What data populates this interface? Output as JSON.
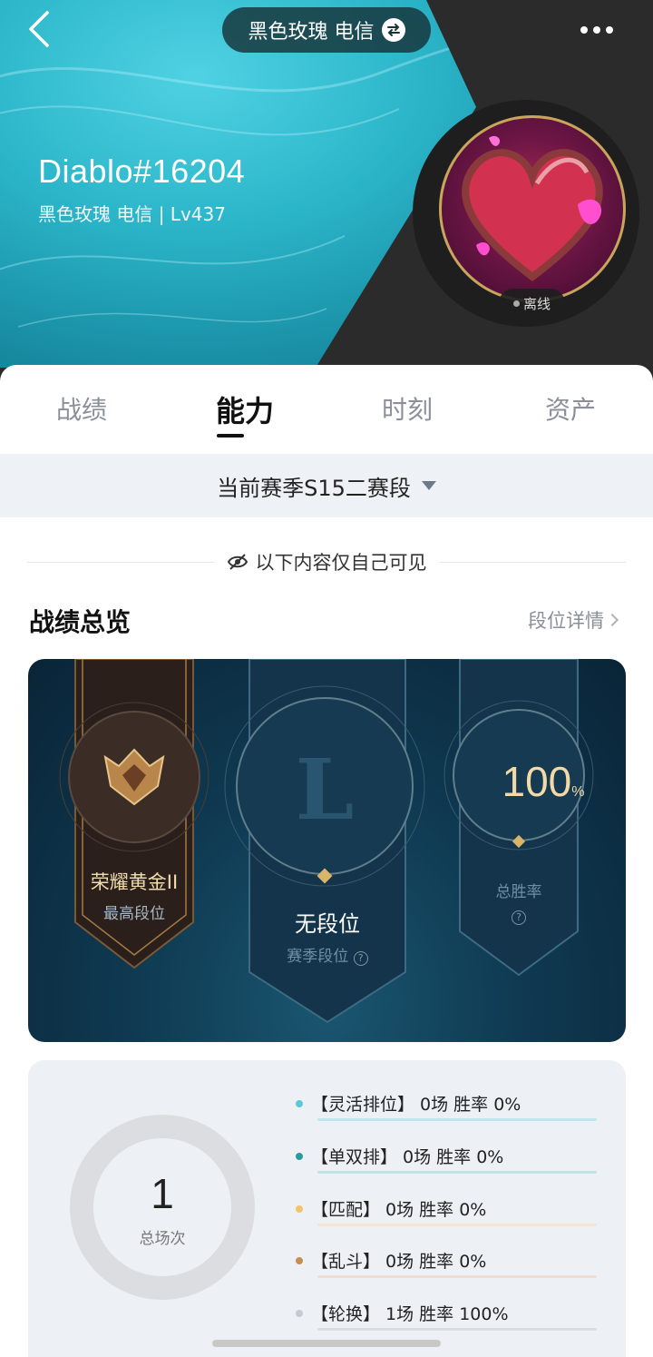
{
  "header": {
    "server_name": "黑色玫瑰 电信",
    "player_name": "Diablo#16204",
    "player_sub": "黑色玫瑰 电信 | Lv437",
    "status": "离线"
  },
  "tabs": [
    {
      "label": "战绩"
    },
    {
      "label": "能力"
    },
    {
      "label": "时刻"
    },
    {
      "label": "资产"
    }
  ],
  "season_selector": "当前赛季S15二赛段",
  "privacy_note": "以下内容仅自己可见",
  "overview": {
    "title": "战绩总览",
    "link": "段位详情"
  },
  "rank": {
    "highest": {
      "value": "荣耀黄金II",
      "label": "最高段位"
    },
    "season": {
      "value": "无段位",
      "label": "赛季段位"
    },
    "winrate": {
      "value": "100",
      "unit": "%",
      "label": "总胜率"
    }
  },
  "stats": {
    "total": "1",
    "total_label": "总场次",
    "modes": [
      {
        "text": "【灵活排位】 0场  胜率 0%",
        "color": "#5bc8d8"
      },
      {
        "text": "【单双排】 0场  胜率 0%",
        "color": "#2a9a9a"
      },
      {
        "text": "【匹配】 0场  胜率 0%",
        "color": "#f0c46a"
      },
      {
        "text": "【乱斗】 0场  胜率 0%",
        "color": "#c48f4f"
      },
      {
        "text": "【轮换】 1场  胜率 100%",
        "color": "#c5cbd3"
      }
    ]
  },
  "colors": {
    "accent_teal": "#2bb5c9",
    "gold": "#c9a55c"
  }
}
